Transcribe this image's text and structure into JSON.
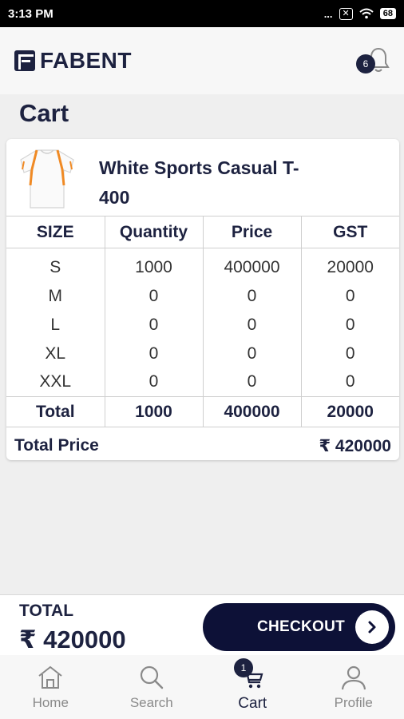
{
  "status_bar": {
    "time": "3:13 PM",
    "dots": "...",
    "battery": "68"
  },
  "header": {
    "brand": "FABENT",
    "notification_count": "6"
  },
  "page": {
    "title": "Cart"
  },
  "cart_item": {
    "name": "White Sports Casual T-400",
    "columns": [
      "SIZE",
      "Quantity",
      "Price",
      "GST"
    ],
    "rows": [
      {
        "size": "S",
        "quantity": "1000",
        "price": "400000",
        "gst": "20000"
      },
      {
        "size": "M",
        "quantity": "0",
        "price": "0",
        "gst": "0"
      },
      {
        "size": "L",
        "quantity": "0",
        "price": "0",
        "gst": "0"
      },
      {
        "size": "XL",
        "quantity": "0",
        "price": "0",
        "gst": "0"
      },
      {
        "size": "XXL",
        "quantity": "0",
        "price": "0",
        "gst": "0"
      }
    ],
    "total_row": {
      "label": "Total",
      "quantity": "1000",
      "price": "400000",
      "gst": "20000"
    },
    "total_price_label": "Total Price",
    "total_price_value": "₹ 420000"
  },
  "summary": {
    "label": "TOTAL",
    "value": "₹ 420000",
    "checkout_label": "CHECKOUT"
  },
  "nav": {
    "items": [
      {
        "label": "Home",
        "icon": "home-icon"
      },
      {
        "label": "Search",
        "icon": "search-icon"
      },
      {
        "label": "Cart",
        "icon": "cart-icon",
        "badge": "1",
        "active": true
      },
      {
        "label": "Profile",
        "icon": "profile-icon"
      }
    ]
  },
  "colors": {
    "primary": "#1d2240",
    "button": "#0d1137",
    "accent": "#f08a24",
    "background": "#efefef"
  }
}
